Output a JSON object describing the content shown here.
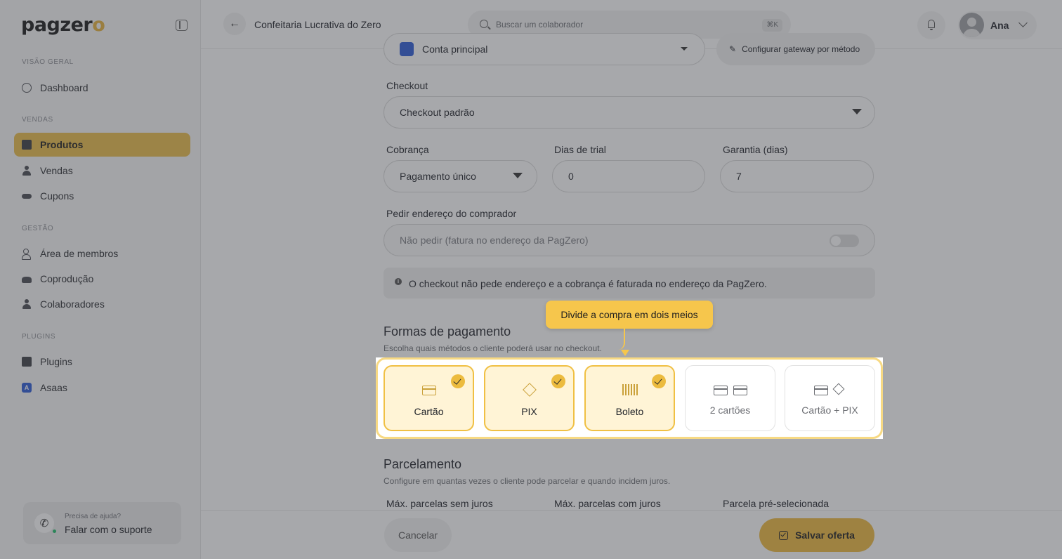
{
  "app": {
    "logo_text": "pagzer",
    "logo_accent": "o",
    "brand_color": "#ecbd49"
  },
  "sidebar": {
    "sections": [
      {
        "title": "VISÃO GERAL"
      },
      {
        "title": "VENDAS"
      },
      {
        "title": "GESTÃO"
      },
      {
        "title": "PLUGINS"
      }
    ],
    "items": [
      {
        "label": "Dashboard",
        "icon": "dashboard-icon"
      },
      {
        "label": "Produtos",
        "icon": "box-icon",
        "active": true
      },
      {
        "label": "Vendas",
        "icon": "sales-icon"
      },
      {
        "label": "Cupons",
        "icon": "coupon-icon"
      },
      {
        "label": "Área de membros",
        "icon": "members-icon"
      },
      {
        "label": "Coprodução",
        "icon": "handshake-icon"
      },
      {
        "label": "Colaboradores",
        "icon": "user-icon"
      },
      {
        "label": "Plugins",
        "icon": "puzzle-icon"
      },
      {
        "label": "Asaas",
        "icon": "asaas-icon",
        "icon_letter": "A"
      }
    ],
    "help": {
      "small": "Precisa de ajuda?",
      "big": "Falar com o suporte"
    }
  },
  "topbar": {
    "title": "Confeitaria Lucrativa do Zero",
    "search_placeholder": "Buscar um colaborador",
    "search_shortcut": "⌘K",
    "user_name": "Ana"
  },
  "form": {
    "account": {
      "value": "Conta principal",
      "gateway_link": "Configurar gateway por método"
    },
    "checkout": {
      "label": "Checkout",
      "value": "Checkout padrão"
    },
    "cobranca": {
      "label": "Cobrança",
      "value": "Pagamento único"
    },
    "trial": {
      "label": "Dias de trial",
      "value": "0"
    },
    "garantia": {
      "label": "Garantia (dias)",
      "value": "7"
    },
    "endereco": {
      "label": "Pedir endereço do comprador",
      "value": "Não pedir (fatura no endereço da PagZero)",
      "toggle_on": false
    },
    "info": "O checkout não pede endereço e a cobrança é faturada no endereço da PagZero."
  },
  "payments": {
    "title": "Formas de pagamento",
    "subtitle": "Escolha quais métodos o cliente poderá usar no checkout.",
    "methods": [
      {
        "label": "Cartão",
        "selected": true,
        "icon": "credit-card-icon"
      },
      {
        "label": "PIX",
        "selected": true,
        "icon": "pix-icon"
      },
      {
        "label": "Boleto",
        "selected": true,
        "icon": "barcode-icon"
      },
      {
        "label": "2 cartões",
        "selected": false,
        "icon": "two-cards-icon"
      },
      {
        "label": "Cartão + PIX",
        "selected": false,
        "icon": "card-pix-icon"
      }
    ]
  },
  "installments": {
    "title": "Parcelamento",
    "subtitle": "Configure em quantas vezes o cliente pode parcelar e quando incidem juros.",
    "col1": "Máx. parcelas sem juros",
    "col2": "Máx. parcelas com juros",
    "col3": "Parcela pré-selecionada"
  },
  "footer": {
    "cancel": "Cancelar",
    "save": "Salvar oferta"
  },
  "tour": {
    "tooltip": "Divide a compra em dois meios"
  }
}
